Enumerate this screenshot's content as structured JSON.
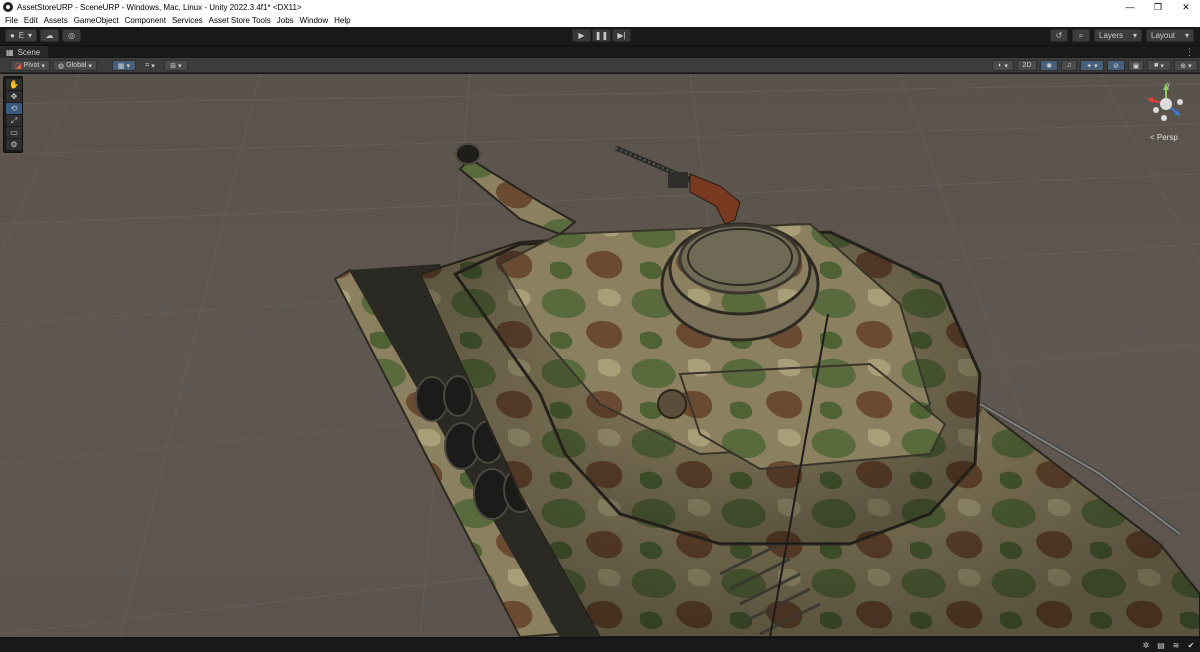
{
  "window": {
    "title": "AssetStoreURP - SceneURP - Windows, Mac, Linux - Unity 2022.3.4f1* <DX11>",
    "minimize": "—",
    "restore": "❐",
    "close": "✕"
  },
  "menu": [
    "File",
    "Edit",
    "Assets",
    "GameObject",
    "Component",
    "Services",
    "Asset Store Tools",
    "Jobs",
    "Window",
    "Help"
  ],
  "toolbar": {
    "account_label": "E",
    "play_icon": "▶",
    "pause_icon": "❚❚",
    "step_icon": "▶|",
    "layers_label": "Layers",
    "layout_label": "Layout"
  },
  "scene_tab": {
    "label": "Scene"
  },
  "scene_toolbar": {
    "pivot_label": "Pivot",
    "global_label": "Global",
    "mode_2d_label": "2D"
  },
  "tools": [
    "✋",
    "✥",
    "⟲",
    "⤢",
    "▭",
    "⚙"
  ],
  "gizmo": {
    "axis_y": "y",
    "persp_label": "< Persp"
  }
}
